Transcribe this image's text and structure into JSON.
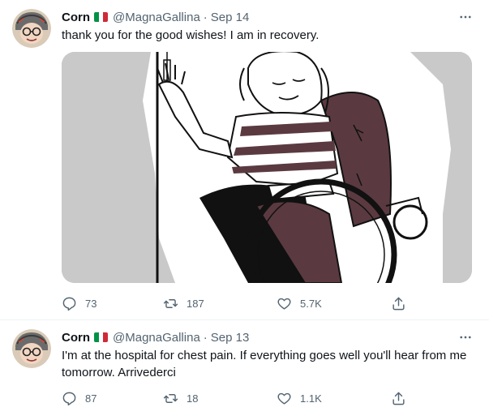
{
  "tweets": [
    {
      "author": {
        "name": "Corn",
        "flag": "italy-flag",
        "handle": "@MagnaGallina"
      },
      "dot": "·",
      "date": "Sep 14",
      "text": "thank you for the good wishes! I am in recovery.",
      "media": "drawing of person in wheelchair waving",
      "stats": {
        "replies": "73",
        "retweets": "187",
        "likes": "5.7K"
      }
    },
    {
      "author": {
        "name": "Corn",
        "flag": "italy-flag",
        "handle": "@MagnaGallina"
      },
      "dot": "·",
      "date": "Sep 13",
      "text": "I'm at the hospital for chest pain. If everything goes well you'll hear from me tomorrow. Arrivederci",
      "stats": {
        "replies": "87",
        "retweets": "18",
        "likes": "1.1K"
      }
    }
  ],
  "colors": {
    "text": "#0f1419",
    "secondary": "#536471",
    "divider": "#eff3f4",
    "flag_green": "#009246",
    "flag_white": "#ffffff",
    "flag_red": "#ce2b37",
    "chair": "#5a3a40"
  },
  "icons": [
    "avatar",
    "italy-flag",
    "more-icon",
    "reply-icon",
    "retweet-icon",
    "like-icon",
    "share-icon"
  ]
}
